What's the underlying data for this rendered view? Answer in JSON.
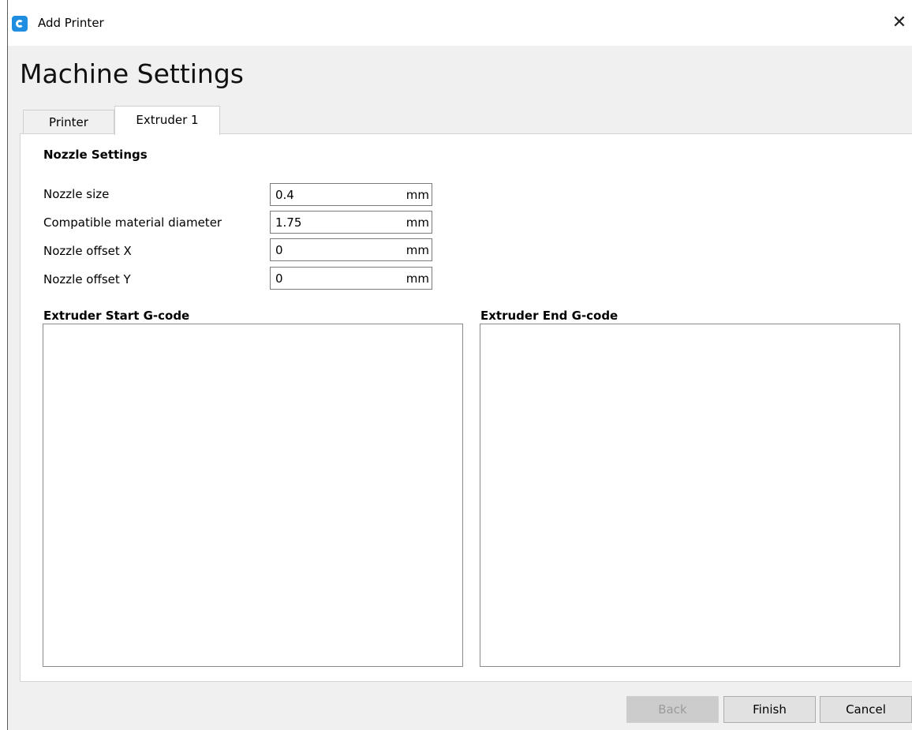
{
  "window": {
    "title": "Add Printer",
    "close_glyph": "✕"
  },
  "page": {
    "heading": "Machine Settings"
  },
  "tabs": [
    {
      "label": "Printer",
      "active": false
    },
    {
      "label": "Extruder 1",
      "active": true
    }
  ],
  "nozzle": {
    "section_title": "Nozzle Settings",
    "fields": [
      {
        "label": "Nozzle size",
        "value": "0.4",
        "unit": "mm"
      },
      {
        "label": "Compatible material diameter",
        "value": "1.75",
        "unit": "mm"
      },
      {
        "label": "Nozzle offset X",
        "value": "0",
        "unit": "mm"
      },
      {
        "label": "Nozzle offset Y",
        "value": "0",
        "unit": "mm"
      }
    ]
  },
  "gcode": {
    "start_title": "Extruder Start G-code",
    "start_value": "",
    "end_title": "Extruder End G-code",
    "end_value": ""
  },
  "buttons": {
    "back": "Back",
    "finish": "Finish",
    "cancel": "Cancel"
  },
  "icons": {
    "app": "app-logo-icon",
    "close": "close-icon"
  },
  "colors": {
    "accent": "#1f8ee0",
    "window_bg": "#f0f0f0",
    "panel_bg": "#ffffff"
  }
}
